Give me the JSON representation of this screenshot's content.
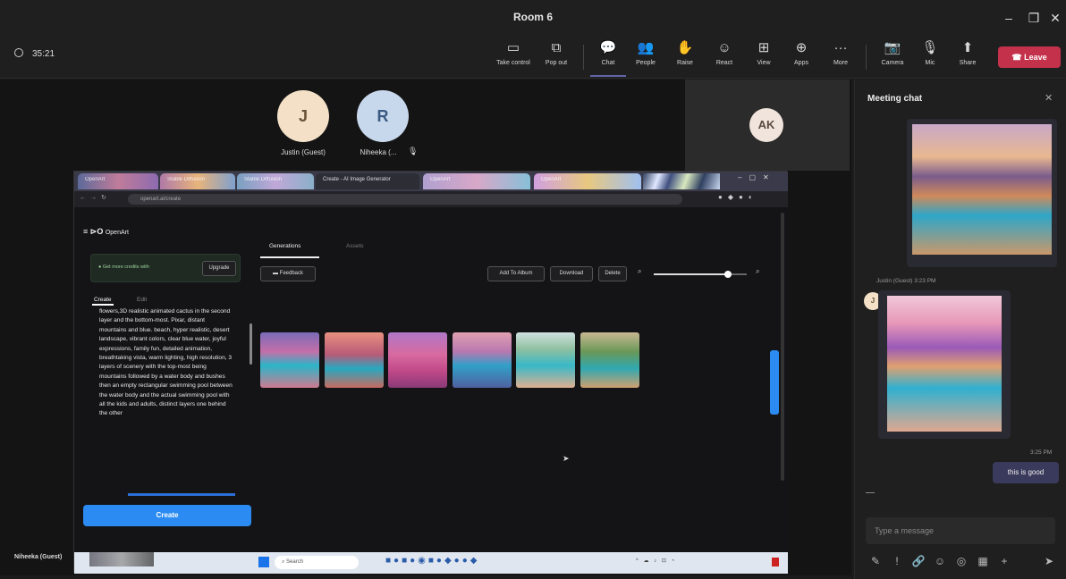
{
  "window": {
    "title": "Room 6",
    "minimize": "–",
    "maximize": "❐",
    "close": "✕"
  },
  "meeting": {
    "timer": "35:21"
  },
  "toolbar": {
    "items": [
      {
        "label": "Take control",
        "icon": "▭"
      },
      {
        "label": "Pop out",
        "icon": "⧉"
      },
      {
        "label": "Chat",
        "icon": "💬"
      },
      {
        "label": "People",
        "icon": "👥"
      },
      {
        "label": "Raise",
        "icon": "✋"
      },
      {
        "label": "React",
        "icon": "☺"
      },
      {
        "label": "View",
        "icon": "⊞"
      },
      {
        "label": "Apps",
        "icon": "⊕"
      },
      {
        "label": "More",
        "icon": "···"
      },
      {
        "label": "Camera",
        "icon": "📷"
      },
      {
        "label": "Mic",
        "icon": "🎙"
      },
      {
        "label": "Share",
        "icon": "⬆"
      }
    ],
    "leave_label": "Leave",
    "accent": "#6264a7",
    "leave_color": "#c4314b"
  },
  "participants": [
    {
      "initial": "J",
      "name": "Justin (Guest)",
      "color": "#f3e0c6"
    },
    {
      "initial": "R",
      "name": "Niheeka (...",
      "color": "#c8d8ec"
    }
  ],
  "video_tile": {
    "initial": "AK",
    "color": "#f0e4dc"
  },
  "presenter_label": "Niheeka (Guest)",
  "shared": {
    "tabs": [
      "OpenArt",
      "Stable Diffusion",
      "Create - AI Image Generator",
      "OpenArt",
      "OpenArt"
    ],
    "url": "openart.ai/create",
    "app_name": "OpenArt",
    "upgrade_label": "Upgrade",
    "credits_label": "● Get more credits with",
    "upgrade_small": "Upgrade",
    "side_tabs": [
      "Create",
      "Edit"
    ],
    "main_tabs": [
      "Generations",
      "Assets"
    ],
    "feedback_label": "Feedback",
    "actions": [
      "Add To Album",
      "Download",
      "Delete"
    ],
    "zoom_level": 0.8,
    "prompt": "flowers,3D realistic animated cactus in the second layer and the bottom-most. Pixar, distant mountains and blue. beach, hyper realistic, desert landscape, vibrant colors, clear blue water, joyful expressions, family fun, detailed animation, breathtaking vista, warm lighting, high resolution, 3 layers of scenery with the top-most being mountains followed by a water body and bushes then an empty rectangular swimming pool between the water body and the actual swimming pool with all the kids and adults, distinct layers one behind the other",
    "create_label": "Create",
    "taskbar_search": "Search"
  },
  "chat": {
    "title": "Meeting chat",
    "sender_line": "Justin (Guest)   3:23 PM",
    "reply_time": "3:25 PM",
    "reply_text": "this is good",
    "input_placeholder": "Type a message",
    "tools": [
      "✎",
      "!",
      "🔗",
      "☺",
      "◎",
      "▦",
      "+"
    ],
    "send_icon": "➤"
  }
}
